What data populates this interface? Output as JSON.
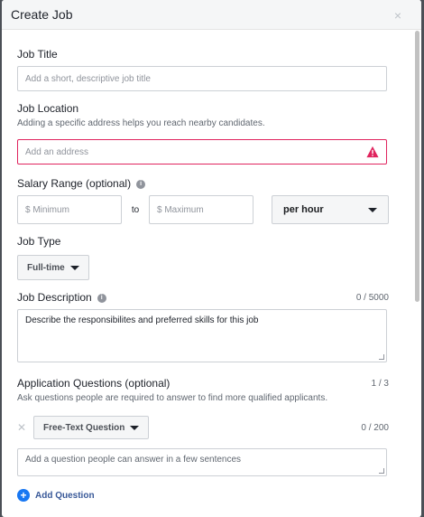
{
  "dialog": {
    "title": "Create Job",
    "close_symbol": "×"
  },
  "job_title": {
    "label": "Job Title",
    "placeholder": "Add a short, descriptive job title"
  },
  "job_location": {
    "label": "Job Location",
    "sublabel": "Adding a specific address helps you reach nearby candidates.",
    "placeholder": "Add an address",
    "state": "error",
    "error_color": "#e0245e"
  },
  "salary": {
    "label": "Salary Range (optional)",
    "info_icon": "info-icon",
    "min_placeholder": "$ Minimum",
    "to_label": "to",
    "max_placeholder": "$ Maximum",
    "period_selected": "per hour"
  },
  "job_type": {
    "label": "Job Type",
    "selected": "Full-time"
  },
  "job_description": {
    "label": "Job Description",
    "counter": "0 / 5000",
    "text": "Describe the responsibilites and preferred skills for this job"
  },
  "application_questions": {
    "label": "Application Questions (optional)",
    "counter": "1 / 3",
    "sublabel": "Ask questions people are required to answer to find more qualified applicants.",
    "question": {
      "type_selected": "Free-Text Question",
      "counter": "0 / 200",
      "placeholder": "Add a question people can answer in a few sentences"
    },
    "add_label": "Add Question",
    "accent_color": "#1877f2"
  }
}
